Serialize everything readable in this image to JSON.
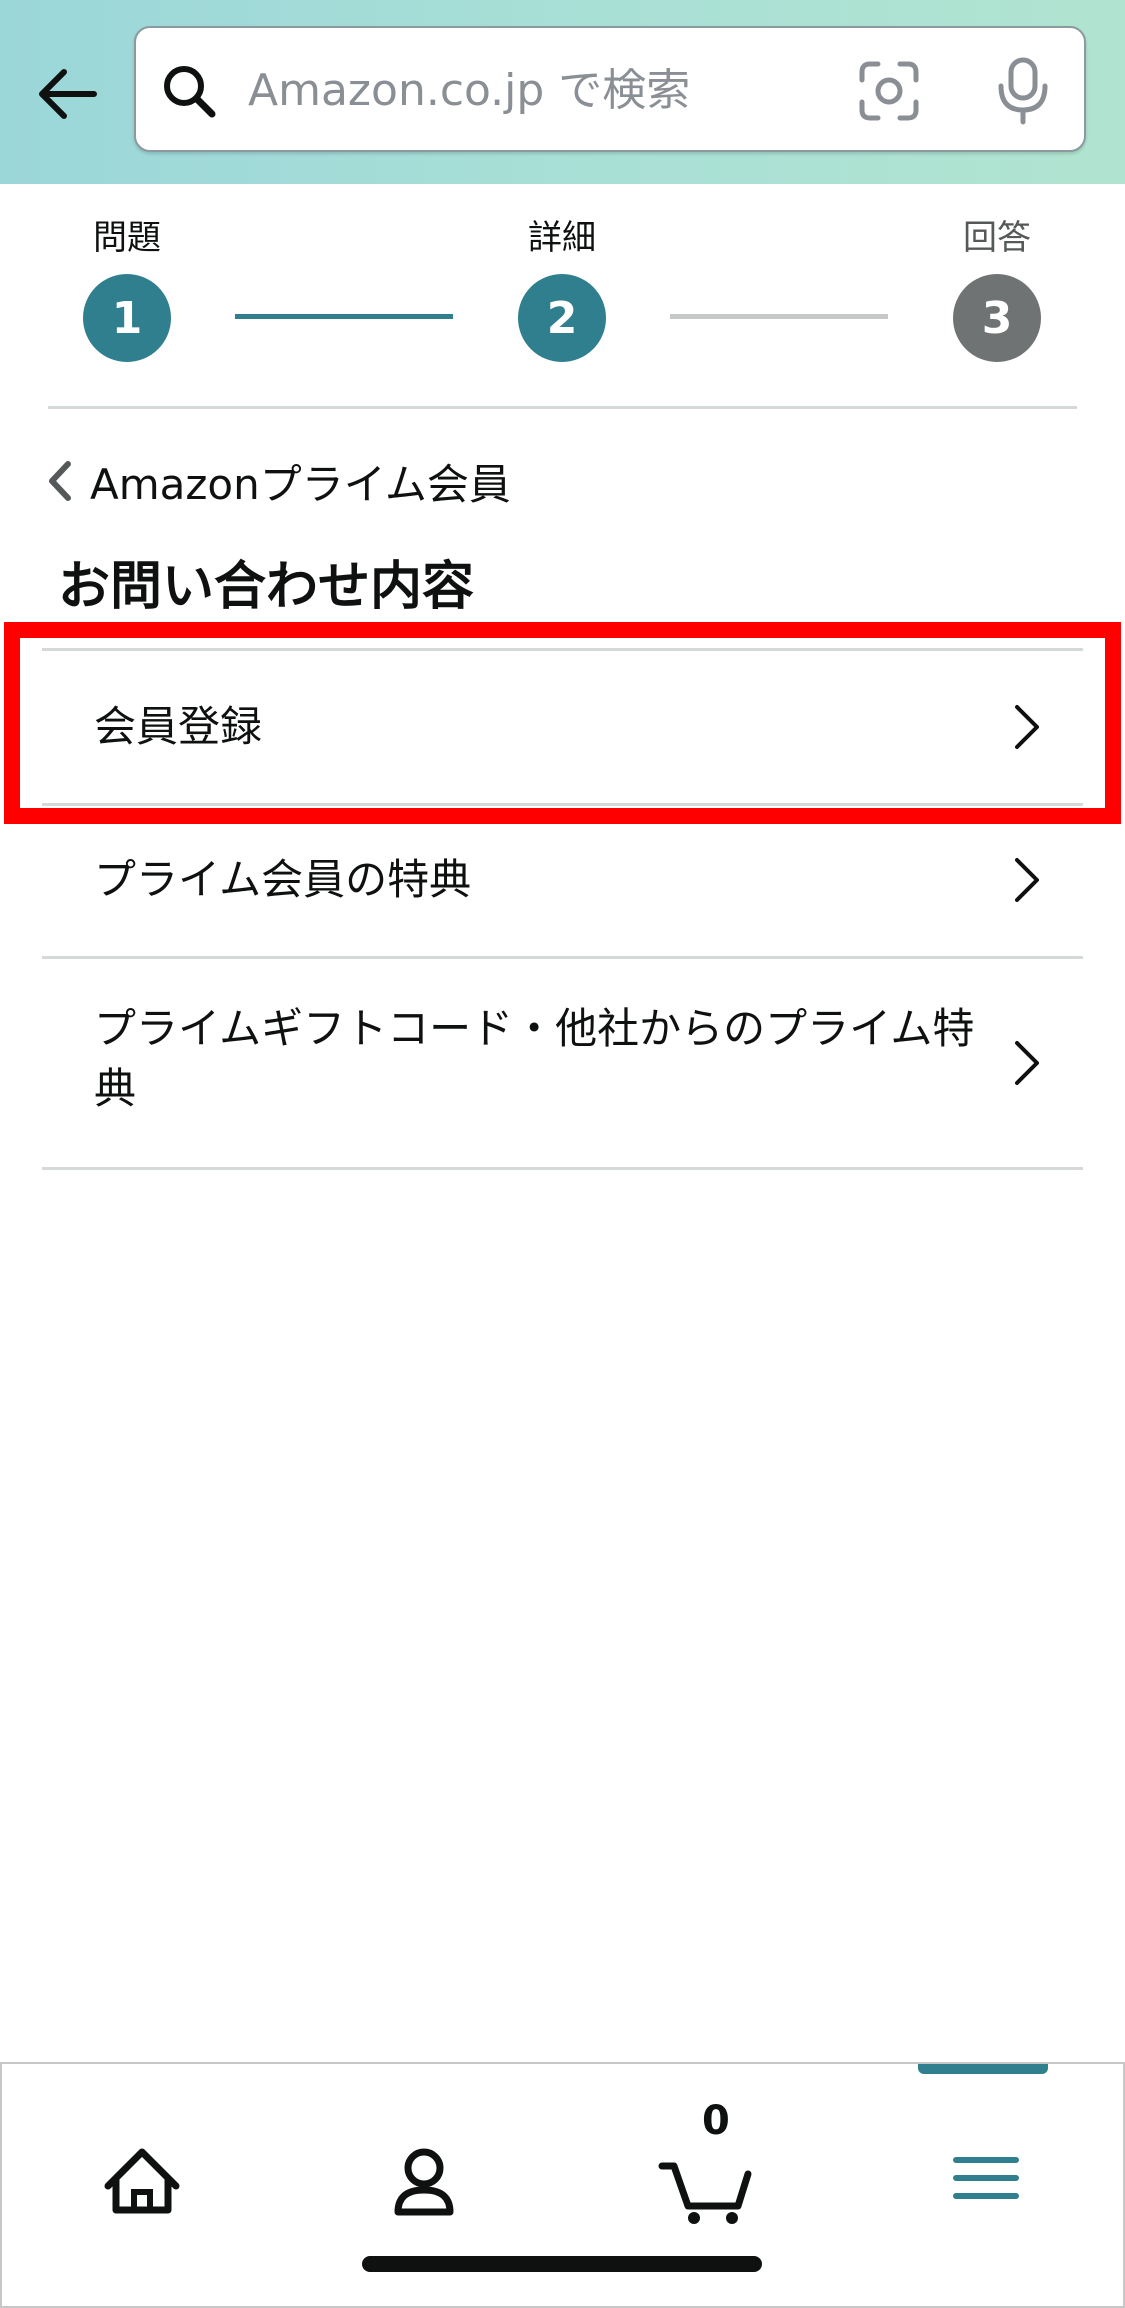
{
  "header": {
    "search_placeholder": "Amazon.co.jp で検索"
  },
  "stepper": {
    "steps": [
      {
        "label": "問題",
        "number": "1",
        "state": "complete"
      },
      {
        "label": "詳細",
        "number": "2",
        "state": "current"
      },
      {
        "label": "回答",
        "number": "3",
        "state": "upcoming"
      }
    ]
  },
  "breadcrumb": {
    "label": "Amazonプライム会員"
  },
  "page": {
    "title": "お問い合わせ内容"
  },
  "options": [
    {
      "label": "会員登録"
    },
    {
      "label": "プライム会員の特典"
    },
    {
      "label": "プライムギフトコード・他社からのプライム特典"
    }
  ],
  "bottom_nav": {
    "items": [
      "home-icon",
      "account-icon",
      "cart-icon",
      "menu-icon"
    ],
    "cart_count": "0",
    "active": "menu-icon"
  },
  "colors": {
    "accent": "#2f7f8f",
    "step_active": "#2f7f8f",
    "step_inactive": "#6f7373",
    "highlight": "#ff0000"
  }
}
